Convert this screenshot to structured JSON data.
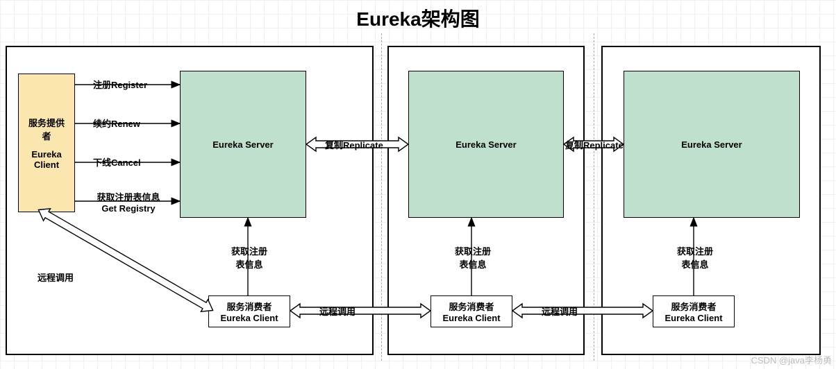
{
  "title": "Eureka架构图",
  "watermark": "CSDN @java李杨勇",
  "provider": {
    "line1": "服务提供",
    "line2": "者",
    "line3": "Eureka",
    "line4": "Client"
  },
  "servers": {
    "s1": "Eureka Server",
    "s2": "Eureka Server",
    "s3": "Eureka Server"
  },
  "consumers": {
    "c1_l1": "服务消费者",
    "c1_l2": "Eureka Client",
    "c2_l1": "服务消费者",
    "c2_l2": "Eureka Client",
    "c3_l1": "服务消费者",
    "c3_l2": "Eureka Client"
  },
  "edges": {
    "register": "注册Register",
    "renew": "续约Renew",
    "cancel": "下线Cancel",
    "get_registry_l1": "获取注册表信息",
    "get_registry_l2": "Get Registry",
    "replicate1": "复制Replicate",
    "replicate2": "复制Replicate",
    "get_info1_l1": "获取注册",
    "get_info1_l2": "表信息",
    "get_info2_l1": "获取注册",
    "get_info2_l2": "表信息",
    "get_info3_l1": "获取注册",
    "get_info3_l2": "表信息",
    "remote_call_left": "远程调用",
    "remote_call_mid1": "远程调用",
    "remote_call_mid2": "远程调用"
  }
}
